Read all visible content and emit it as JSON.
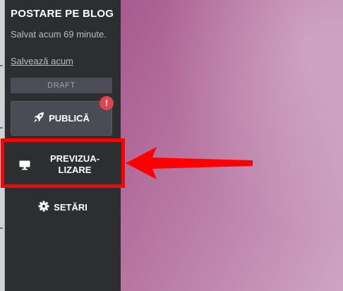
{
  "panel": {
    "title": "POSTARE PE BLOG",
    "saved_status": "Salvat acum 69 minute.",
    "save_now_link": "Salvează acum",
    "status_badge": "DRAFT",
    "publish_label": "PUBLICĂ",
    "alert_symbol": "!",
    "preview_line1": "PREVIZUA-",
    "preview_line2": "LIZARE",
    "settings_label": "SETĂRI"
  },
  "icons": {
    "publish": "rocket-icon",
    "preview": "monitor-icon",
    "settings": "gear-icon",
    "annotation": "red-arrow"
  },
  "colors": {
    "sidebar_bg": "#2d2e30",
    "button_bg": "#4a4c55",
    "alert": "#e0424e",
    "highlight": "#ff0000",
    "canvas_start": "#a85a8f",
    "canvas_end": "#cfa5c3"
  }
}
